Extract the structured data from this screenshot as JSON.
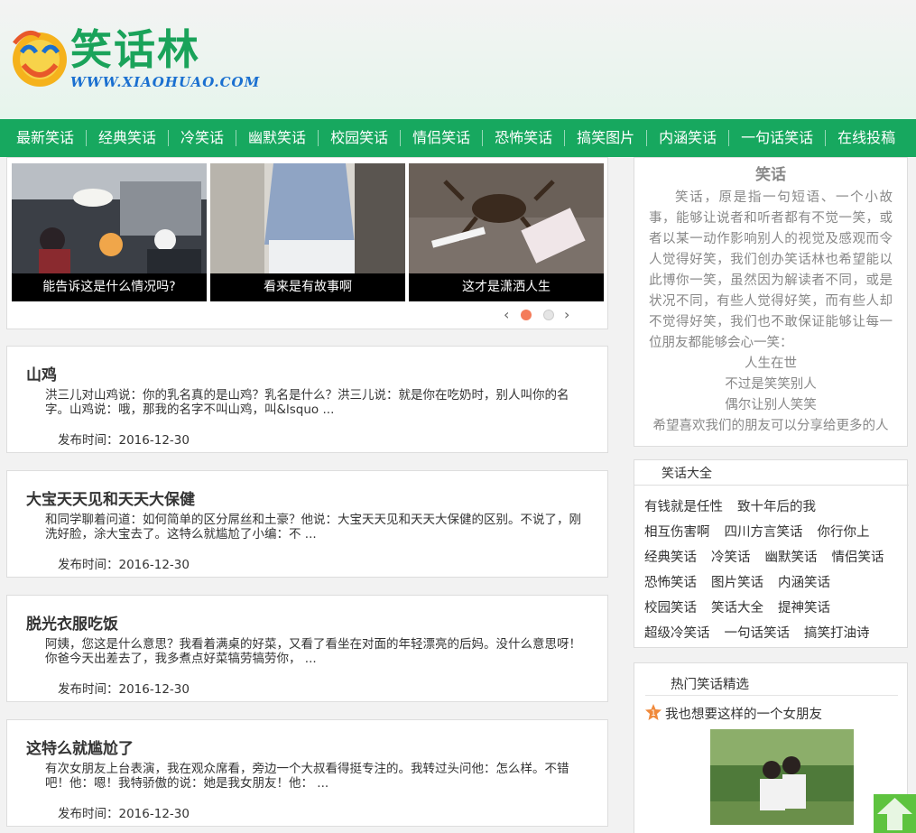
{
  "logo": {
    "name": "笑话林",
    "url": "WWW.XIAOHUAO.COM"
  },
  "nav": [
    "最新笑话",
    "经典笑话",
    "冷笑话",
    "幽默笑话",
    "校园笑话",
    "情侣笑话",
    "恐怖笑话",
    "搞笑图片",
    "内涵笑话",
    "一句话笑话",
    "在线投稿"
  ],
  "slider": {
    "captions": [
      "能告诉这是什么情况吗?",
      "看来是有故事啊",
      "这才是潇洒人生"
    ],
    "prev": "‹",
    "next": "›"
  },
  "articles": [
    {
      "title": "山鸡",
      "body": "洪三儿对山鸡说：你的乳名真的是山鸡？乳名是什么？洪三儿说：就是你在吃奶时，别人叫你的名字。山鸡说：哦，那我的名字不叫山鸡，叫&lsquo ...",
      "date": "发布时间：2016-12-30"
    },
    {
      "title": "大宝天天见和天天大保健",
      "body": "和同学聊着问道：如何简单的区分屌丝和土豪？他说：大宝天天见和天天大保健的区别。不说了，刚洗好脸，涂大宝去了。这特么就尴尬了小编：不 ...",
      "date": "发布时间：2016-12-30"
    },
    {
      "title": "脱光衣服吃饭",
      "body": "阿姨，您这是什么意思？我看着满桌的好菜，又看了看坐在对面的年轻漂亮的后妈。没什么意思呀！你爸今天出差去了，我多煮点好菜犒劳犒劳你， ...",
      "date": "发布时间：2016-12-30"
    },
    {
      "title": "这特么就尴尬了",
      "body": "有次女朋友上台表演，我在观众席看，旁边一个大叔看得挺专注的。我转过头问他：怎么样。不错吧！他：嗯！我特骄傲的说：她是我女朋友！他： ...",
      "date": "发布时间：2016-12-30"
    }
  ],
  "intro": {
    "title": "笑话",
    "paragraph": "笑话，原是指一句短语、一个小故事，能够让说者和听者都有不觉一笑，或者以某一动作影响别人的视觉及感观而令人觉得好笑，我们创办笑话林也希望能以此博你一笑，虽然因为解读者不同，或是状况不同，有些人觉得好笑，而有些人却不觉得好笑，我们也不敢保证能够让每一位朋友都能够会心一笑：",
    "lines": [
      "人生在世",
      "不过是笑笑别人",
      "偶尔让别人笑笑",
      "希望喜欢我们的朋友可以分享给更多的人"
    ]
  },
  "tags": {
    "title": "笑话大全",
    "items": [
      "有钱就是任性",
      "致十年后的我",
      "相互伤害啊",
      "四川方言笑话",
      "你行你上",
      "经典笑话",
      "冷笑话",
      "幽默笑话",
      "情侣笑话",
      "恐怖笑话",
      "图片笑话",
      "内涵笑话",
      "校园笑话",
      "笑话大全",
      "提神笑话",
      "超级冷笑话",
      "一句话笑话",
      "搞笑打油诗"
    ]
  },
  "hot": {
    "title": "热门笑话精选",
    "rank": "1",
    "item": "我也想要这样的一个女朋友"
  },
  "colors": {
    "nav": "#17a85f",
    "accent_dot": "#f47c5a",
    "top_button": "#5ec33f"
  }
}
